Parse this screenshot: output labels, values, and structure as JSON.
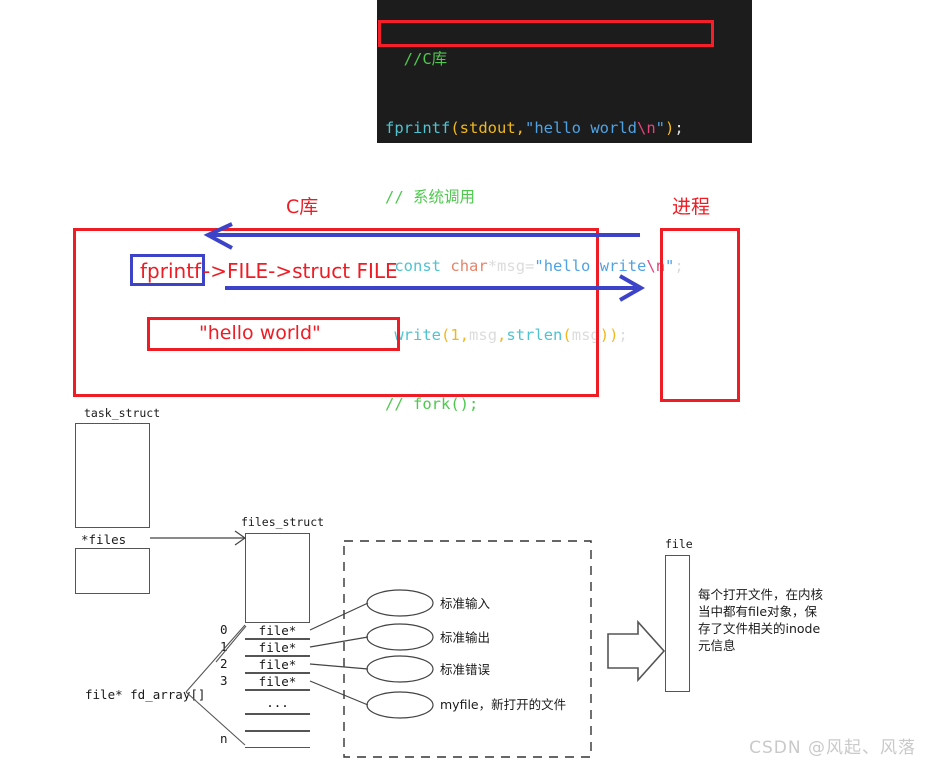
{
  "code": {
    "lines": [
      [
        {
          "t": "  ",
          "c": "tok-plain"
        },
        {
          "t": "//C库",
          "c": "tok-comment"
        }
      ],
      [
        {
          "t": "fprintf",
          "c": "tok-fn"
        },
        {
          "t": "(",
          "c": "tok-punc"
        },
        {
          "t": "stdout",
          "c": "tok-num"
        },
        {
          "t": ",",
          "c": "tok-punc"
        },
        {
          "t": "\"hello world",
          "c": "tok-str"
        },
        {
          "t": "\\n",
          "c": "tok-esc"
        },
        {
          "t": "\"",
          "c": "tok-str"
        },
        {
          "t": ")",
          "c": "tok-punc"
        },
        {
          "t": ";",
          "c": "tok-plain"
        }
      ],
      [
        {
          "t": "// 系统调用",
          "c": "tok-comment"
        }
      ],
      [
        {
          "t": " ",
          "c": "tok-plain"
        },
        {
          "t": "const",
          "c": "tok-kw"
        },
        {
          "t": " ",
          "c": "tok-plain"
        },
        {
          "t": "char",
          "c": "tok-type"
        },
        {
          "t": "*",
          "c": "tok-plain"
        },
        {
          "t": "msg",
          "c": "tok-plain"
        },
        {
          "t": "=",
          "c": "tok-plain"
        },
        {
          "t": "\"hello write",
          "c": "tok-str"
        },
        {
          "t": "\\n",
          "c": "tok-esc"
        },
        {
          "t": "\"",
          "c": "tok-str"
        },
        {
          "t": ";",
          "c": "tok-plain"
        }
      ],
      [
        {
          "t": " ",
          "c": "tok-plain"
        },
        {
          "t": "write",
          "c": "tok-fn"
        },
        {
          "t": "(",
          "c": "tok-punc"
        },
        {
          "t": "1",
          "c": "tok-num"
        },
        {
          "t": ",",
          "c": "tok-punc"
        },
        {
          "t": "msg",
          "c": "tok-plain"
        },
        {
          "t": ",",
          "c": "tok-punc"
        },
        {
          "t": "strlen",
          "c": "tok-fn"
        },
        {
          "t": "(",
          "c": "tok-punc"
        },
        {
          "t": "msg",
          "c": "tok-plain"
        },
        {
          "t": ")",
          "c": "tok-punc"
        },
        {
          "t": ")",
          "c": "tok-punc"
        },
        {
          "t": ";",
          "c": "tok-plain"
        }
      ],
      [
        {
          "t": "// fork();",
          "c": "tok-comment"
        }
      ]
    ],
    "highlight_line": "fprintf(stdout,\"hello world\\n\");",
    "bg_color": "#1c1c1c",
    "highlight_color": "#f41f28"
  },
  "clib_diagram": {
    "clib_title": "C库",
    "process_title": "进程",
    "fprintf_label": "fprintf",
    "chain_label": "->FILE->struct FILE",
    "buffer_label": "\"hello world\"",
    "red_color": "#ee1c24",
    "blue_color": "#3c43c8"
  },
  "kernel_diagram": {
    "task_struct_label": "task_struct",
    "task_struct_rows": [
      "",
      "*files",
      ""
    ],
    "files_struct_label": "files_struct",
    "fd_array_label": "file* fd_array[]",
    "fd_indices": [
      "0",
      "1",
      "2",
      "3",
      "n"
    ],
    "fd_cells": [
      "file*",
      "file*",
      "file*",
      "file*",
      "...",
      "",
      ""
    ],
    "open_files": [
      "标准输入",
      "标准输出",
      "标准错误",
      "myfile，新打开的文件"
    ],
    "file_box_label": "file",
    "file_note_lines": [
      "每个打开文件，在内核",
      "当中都有file对象，保",
      "存了文件相关的inode",
      "元信息"
    ]
  },
  "watermark": "CSDN @风起、风落"
}
